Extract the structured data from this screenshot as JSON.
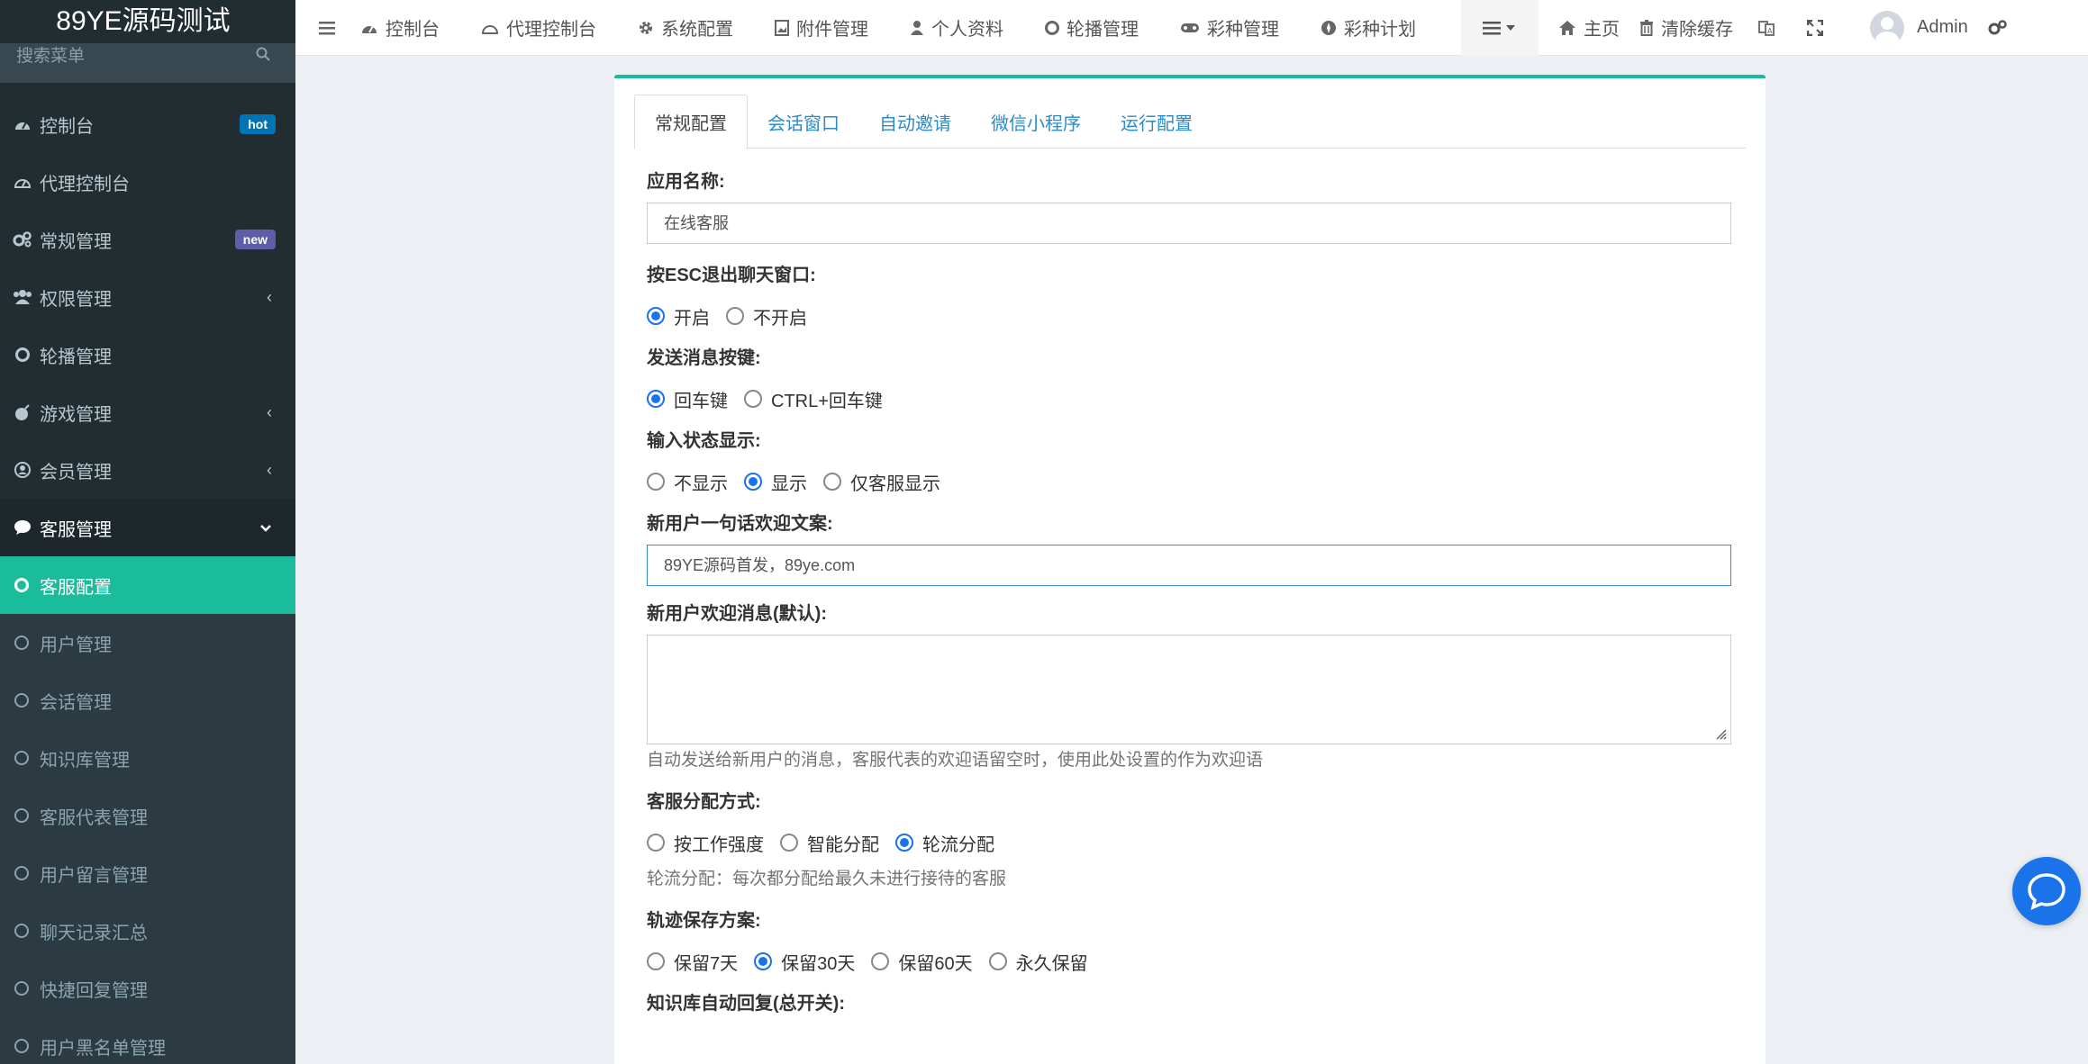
{
  "app": {
    "title": "89YE源码测试"
  },
  "sidebar": {
    "search_placeholder": "搜索菜单",
    "items": [
      {
        "label": "控制台",
        "badge": "hot",
        "badge_color": "#0073b7"
      },
      {
        "label": "代理控制台"
      },
      {
        "label": "常规管理",
        "badge": "new",
        "badge_color": "#605ca8"
      },
      {
        "label": "权限管理",
        "arrow": "‹"
      },
      {
        "label": "轮播管理"
      },
      {
        "label": "游戏管理",
        "arrow": "‹"
      },
      {
        "label": "会员管理",
        "arrow": "‹"
      },
      {
        "label": "客服管理",
        "arrow": "⌄"
      }
    ],
    "subitems": [
      {
        "label": "客服配置"
      },
      {
        "label": "用户管理"
      },
      {
        "label": "会话管理"
      },
      {
        "label": "知识库管理"
      },
      {
        "label": "客服代表管理"
      },
      {
        "label": "用户留言管理"
      },
      {
        "label": "聊天记录汇总"
      },
      {
        "label": "快捷回复管理"
      },
      {
        "label": "用户黑名单管理"
      }
    ]
  },
  "navbar": {
    "items": [
      "控制台",
      "代理控制台",
      "系统配置",
      "附件管理",
      "个人资料",
      "轮播管理",
      "彩种管理",
      "彩种计划"
    ],
    "home": "主页",
    "clear_cache": "清除缓存",
    "user": "Admin"
  },
  "tabs": [
    "常规配置",
    "会话窗口",
    "自动邀请",
    "微信小程序",
    "运行配置"
  ],
  "form": {
    "app_name": {
      "label": "应用名称:",
      "value": "在线客服"
    },
    "esc_exit": {
      "label": "按ESC退出聊天窗口:",
      "options": [
        "开启",
        "不开启"
      ]
    },
    "send_key": {
      "label": "发送消息按键:",
      "options": [
        "回车键",
        "CTRL+回车键"
      ]
    },
    "typing_status": {
      "label": "输入状态显示:",
      "options": [
        "不显示",
        "显示",
        "仅客服显示"
      ]
    },
    "welcome_line": {
      "label": "新用户一句话欢迎文案:",
      "value": "89YE源码首发，89ye.com"
    },
    "welcome_msg": {
      "label": "新用户欢迎消息(默认):",
      "value": "",
      "help": "自动发送给新用户的消息，客服代表的欢迎语留空时，使用此处设置的作为欢迎语"
    },
    "assign": {
      "label": "客服分配方式:",
      "options": [
        "按工作强度",
        "智能分配",
        "轮流分配"
      ],
      "help": "轮流分配：每次都分配给最久未进行接待的客服"
    },
    "track": {
      "label": "轨迹保存方案:",
      "options": [
        "保留7天",
        "保留30天",
        "保留60天",
        "永久保留"
      ]
    },
    "kb_auto": {
      "label": "知识库自动回复(总开关):"
    }
  },
  "colors": {
    "accent": "#18bc9c",
    "sidebar_bg": "#222d32",
    "radio": "#1a73e8"
  }
}
